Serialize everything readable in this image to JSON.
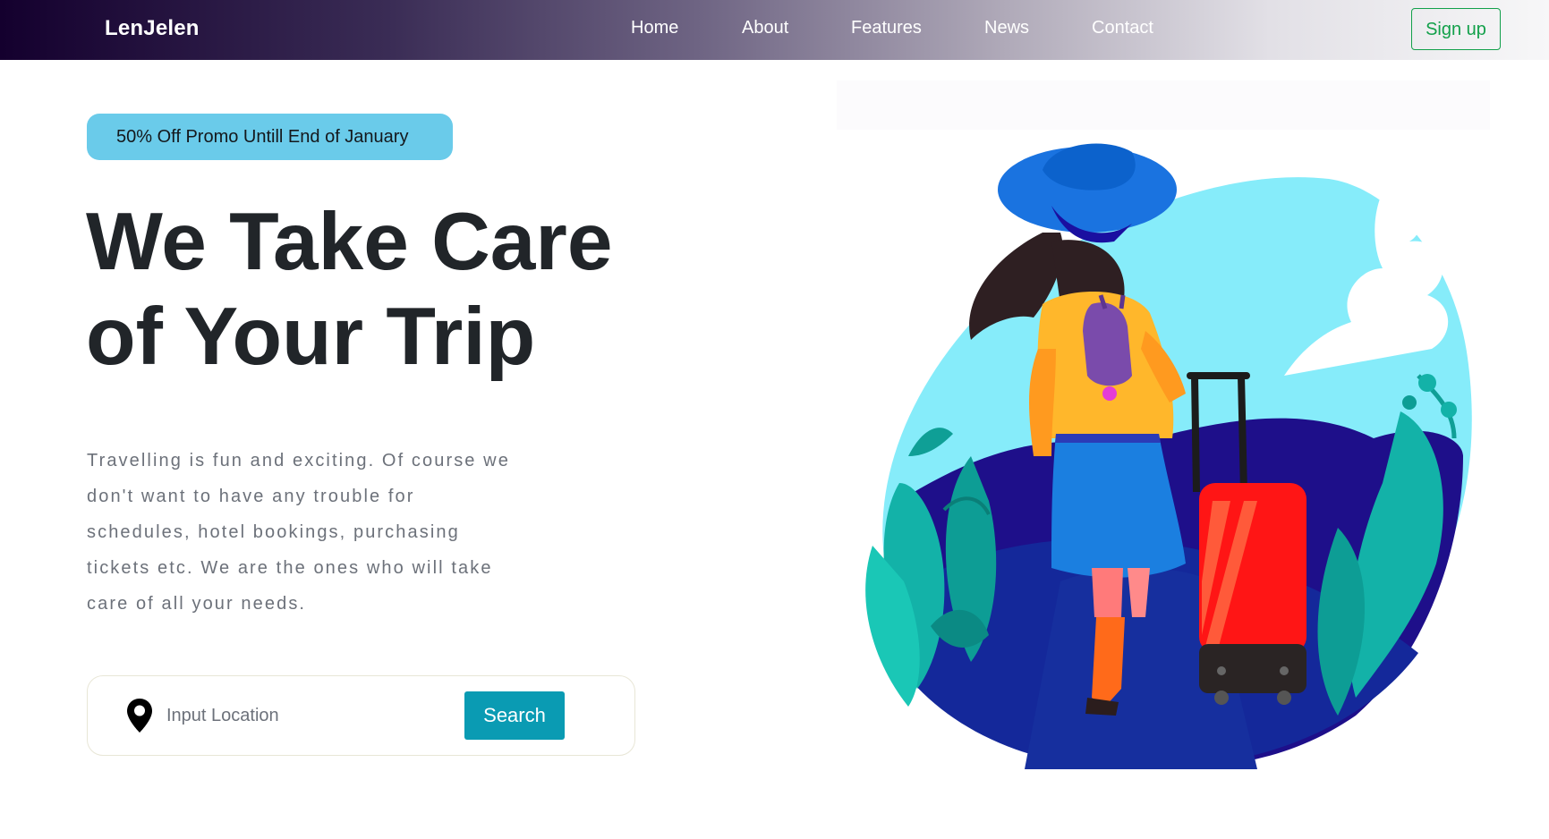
{
  "nav": {
    "brand": "LenJelen",
    "links": [
      "Home",
      "About",
      "Features",
      "News",
      "Contact"
    ],
    "signup_label": "Sign up"
  },
  "hero": {
    "promo": "50% Off Promo Untill End of January",
    "title_line1": "We Take Care",
    "title_line2": "of Your Trip",
    "description": "Travelling is fun and exciting. Of course we don't want to have any trouble for schedules, hotel bookings, purchasing tickets etc. We are the ones who will take care of all your needs."
  },
  "search": {
    "placeholder": "Input Location",
    "value": "",
    "button_label": "Search",
    "icon": "map-pin-icon"
  },
  "colors": {
    "promo_bg": "#6acbea",
    "search_button": "#0a9bb3",
    "signup_accent": "#12a04a",
    "heading": "#212529",
    "body_text": "#6c717a"
  }
}
